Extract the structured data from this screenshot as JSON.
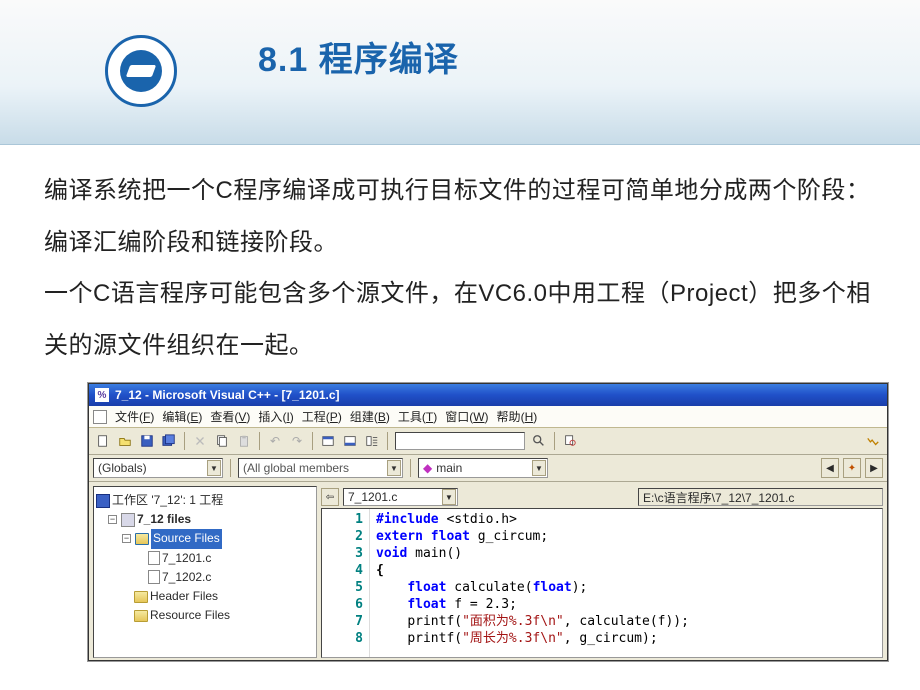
{
  "slide": {
    "title": "8.1 程序编译",
    "para1": "编译系统把一个C程序编译成可执行目标文件的过程可简单地分成两个阶段：编译汇编阶段和链接阶段。",
    "para2": "一个C语言程序可能包含多个源文件，在VC6.0中用工程（Project）把多个相关的源文件组织在一起。"
  },
  "ide": {
    "title": "7_12 - Microsoft Visual C++ - [7_1201.c]",
    "menu": [
      {
        "label": "文件",
        "key": "F"
      },
      {
        "label": "编辑",
        "key": "E"
      },
      {
        "label": "查看",
        "key": "V"
      },
      {
        "label": "插入",
        "key": "I"
      },
      {
        "label": "工程",
        "key": "P"
      },
      {
        "label": "组建",
        "key": "B"
      },
      {
        "label": "工具",
        "key": "T"
      },
      {
        "label": "窗口",
        "key": "W"
      },
      {
        "label": "帮助",
        "key": "H"
      }
    ],
    "combos": {
      "globals": "(Globals)",
      "members": "(All global members",
      "main": "main"
    },
    "editor_tab": "7_1201.c",
    "editor_path": "E:\\c语言程序\\7_12\\7_1201.c",
    "tree": {
      "workspace": "工作区 '7_12': 1 工程",
      "project": "7_12 files",
      "folder_source": "Source Files",
      "file1": "7_1201.c",
      "file2": "7_1202.c",
      "folder_header": "Header Files",
      "folder_resource": "Resource Files"
    },
    "code": {
      "lines": [
        "1",
        "2",
        "3",
        "4",
        "5",
        "6",
        "7",
        "8"
      ],
      "l1_pp": "#include ",
      "l1_inc": "<stdio.h>",
      "l2_kw1": "extern ",
      "l2_kw2": "float ",
      "l2_id": "g_circum;",
      "l3_kw": "void ",
      "l3_id": "main()",
      "l4": "{",
      "l5_kw": "float ",
      "l5_id": "calculate(",
      "l5_kw2": "float",
      "l5_tail": ");",
      "l6_kw": "float ",
      "l6_id": "f = 2.3;",
      "l7a": "printf(",
      "l7s": "\"面积为%.3f\\n\"",
      "l7b": ", calculate(f));",
      "l8a": "printf(",
      "l8s": "\"周长为%.3f\\n\"",
      "l8b": ", g_circum);"
    }
  }
}
